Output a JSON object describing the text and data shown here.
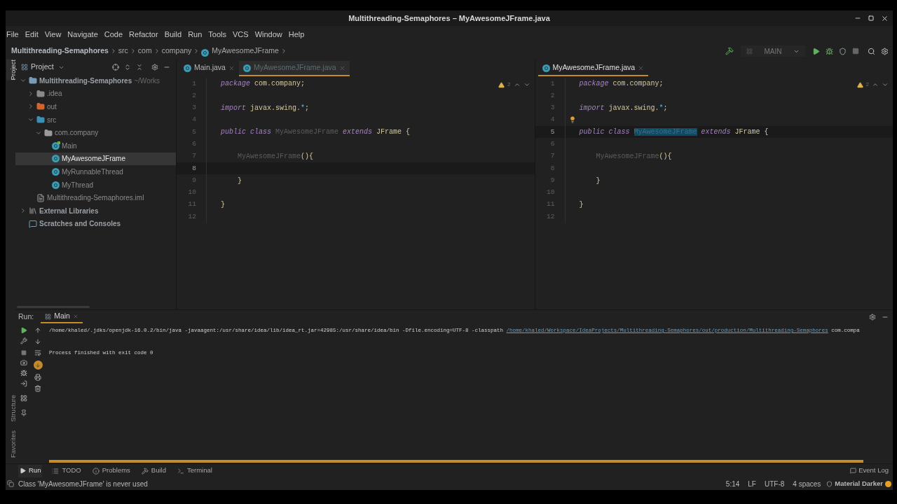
{
  "window": {
    "title": "Multithreading-Semaphores – MyAwesomeJFrame.java"
  },
  "menu": [
    "File",
    "Edit",
    "View",
    "Navigate",
    "Code",
    "Refactor",
    "Build",
    "Run",
    "Tools",
    "VCS",
    "Window",
    "Help"
  ],
  "breadcrumb": [
    {
      "label": "Multithreading-Semaphores",
      "kind": "project"
    },
    {
      "label": "src",
      "kind": "folder"
    },
    {
      "label": "com",
      "kind": "folder"
    },
    {
      "label": "company",
      "kind": "folder"
    },
    {
      "label": "MyAwesomeJFrame",
      "kind": "class"
    }
  ],
  "toolbar": {
    "run_config": "MAIN"
  },
  "side_stripe": {
    "top": [
      {
        "label": "Project",
        "selected": true
      }
    ],
    "bottom": [
      {
        "label": "Structure",
        "selected": false
      },
      {
        "label": "Favorites",
        "selected": false
      }
    ]
  },
  "project": {
    "title": "Project",
    "tree": [
      {
        "label": "Multithreading-Semaphores",
        "path": "~/Works",
        "kind": "module",
        "expanded": true,
        "selected": false,
        "children": [
          {
            "label": ".idea",
            "kind": "folder",
            "expanded": false,
            "selected": false
          },
          {
            "label": "out",
            "kind": "excluded-folder",
            "expanded": false,
            "selected": false
          },
          {
            "label": "src",
            "kind": "source-folder",
            "expanded": true,
            "selected": false,
            "children": [
              {
                "label": "com.company",
                "kind": "package",
                "expanded": true,
                "selected": false,
                "children": [
                  {
                    "label": "Main",
                    "kind": "main-class",
                    "selected": false
                  },
                  {
                    "label": "MyAwesomeJFrame",
                    "kind": "class",
                    "selected": true
                  },
                  {
                    "label": "MyRunnableThread",
                    "kind": "class",
                    "selected": false
                  },
                  {
                    "label": "MyThread",
                    "kind": "class",
                    "selected": false
                  }
                ]
              }
            ]
          },
          {
            "label": "Multithreading-Semaphores.iml",
            "kind": "file",
            "selected": false
          }
        ]
      },
      {
        "label": "External Libraries",
        "kind": "libraries",
        "expanded": false,
        "selected": false
      },
      {
        "label": "Scratches and Consoles",
        "kind": "scratches",
        "selected": false
      }
    ]
  },
  "editors": [
    {
      "tabs": [
        {
          "label": "Main.java",
          "selected": false,
          "dragging": false
        },
        {
          "label": "MyAwesomeJFrame.java",
          "selected": true,
          "dragging": true
        }
      ],
      "warnings": "2",
      "lightbulb": false,
      "lines": [
        {
          "number": "1",
          "current": false,
          "tokens": [
            {
              "text": "package",
              "kind": "keyword"
            },
            {
              "text": " com.company;",
              "kind": "plain"
            }
          ]
        },
        {
          "number": "2",
          "current": false
        },
        {
          "number": "3",
          "current": false,
          "tokens": [
            {
              "text": "import",
              "kind": "keyword"
            },
            {
              "text": " javax.swing.",
              "kind": "plain"
            },
            {
              "text": "*",
              "kind": "operator"
            },
            {
              "text": ";",
              "kind": "plain"
            }
          ]
        },
        {
          "number": "4",
          "current": false
        },
        {
          "number": "5",
          "current": false,
          "tokens": [
            {
              "text": "public class ",
              "kind": "keyword"
            },
            {
              "text": "MyAwesomeJFrame",
              "kind": "unused"
            },
            {
              "text": " extends",
              "kind": "keyword"
            },
            {
              "text": " JFrame {",
              "kind": "plain"
            }
          ]
        },
        {
          "number": "6",
          "current": false
        },
        {
          "number": "7",
          "current": false,
          "tokens": [
            {
              "text": "    MyAwesomeJFrame",
              "kind": "unused"
            },
            {
              "text": "(){",
              "kind": "plain"
            }
          ]
        },
        {
          "number": "8",
          "current": true
        },
        {
          "number": "9",
          "current": false,
          "tokens": [
            {
              "text": "    }",
              "kind": "plain"
            }
          ]
        },
        {
          "number": "10",
          "current": false
        },
        {
          "number": "11",
          "current": false,
          "tokens": [
            {
              "text": "}",
              "kind": "plain"
            }
          ]
        },
        {
          "number": "12",
          "current": false
        }
      ]
    },
    {
      "tabs": [
        {
          "label": "MyAwesomeJFrame.java",
          "selected": true,
          "dragging": false
        }
      ],
      "warnings": "2",
      "lightbulb": true,
      "lines": [
        {
          "number": "1",
          "current": false,
          "tokens": [
            {
              "text": "package",
              "kind": "keyword"
            },
            {
              "text": " com.company;",
              "kind": "plain"
            }
          ]
        },
        {
          "number": "2",
          "current": false
        },
        {
          "number": "3",
          "current": false,
          "tokens": [
            {
              "text": "import",
              "kind": "keyword"
            },
            {
              "text": " javax.swing.",
              "kind": "plain"
            },
            {
              "text": "*",
              "kind": "operator"
            },
            {
              "text": ";",
              "kind": "plain"
            }
          ]
        },
        {
          "number": "4",
          "current": false
        },
        {
          "number": "5",
          "current": true,
          "tokens": [
            {
              "text": "public class ",
              "kind": "keyword"
            },
            {
              "text": "MyAwesomeJFrame",
              "kind": "highlighted"
            },
            {
              "text": " extends",
              "kind": "keyword"
            },
            {
              "text": " JFrame {",
              "kind": "plain"
            }
          ]
        },
        {
          "number": "6",
          "current": false
        },
        {
          "number": "7",
          "current": false,
          "tokens": [
            {
              "text": "    MyAwesomeJFrame",
              "kind": "unused"
            },
            {
              "text": "(){",
              "kind": "plain"
            }
          ]
        },
        {
          "number": "8",
          "current": false
        },
        {
          "number": "9",
          "current": false,
          "tokens": [
            {
              "text": "    }",
              "kind": "plain"
            }
          ]
        },
        {
          "number": "10",
          "current": false
        },
        {
          "number": "11",
          "current": false,
          "tokens": [
            {
              "text": "}",
              "kind": "plain"
            }
          ]
        },
        {
          "number": "12",
          "current": false
        }
      ]
    }
  ],
  "run": {
    "label": "Run:",
    "tabs": [
      {
        "label": "Main",
        "selected": true
      }
    ],
    "console": [
      [
        {
          "text": "/home/khaled/.jdks/openjdk-16.0.2/bin/java -javaagent:/usr/share/idea/lib/idea_rt.jar=42985:/usr/share/idea/bin -Dfile.encoding=UTF-8 -classpath ",
          "kind": "plain"
        },
        {
          "text": "/home/khaled/Workspace/IdeaProjects/Multithreading-Semaphores/out/production/Multithreading-Semaphores",
          "kind": "link"
        },
        {
          "text": " com.compa",
          "kind": "plain"
        }
      ],
      [
        {
          "text": "Process finished with exit code 0",
          "kind": "plain"
        }
      ]
    ],
    "scroll_to_end": true
  },
  "tool_tabs": [
    {
      "label": "Run",
      "kind": "run",
      "selected": true
    },
    {
      "label": "TODO",
      "kind": "todo",
      "selected": false
    },
    {
      "label": "Problems",
      "kind": "problems",
      "selected": false
    },
    {
      "label": "Build",
      "kind": "build",
      "selected": false
    },
    {
      "label": "Terminal",
      "kind": "terminal",
      "selected": false
    }
  ],
  "event_log": "Event Log",
  "status_bar": {
    "message": "Class 'MyAwesomeJFrame' is never used",
    "items": [
      "5:14",
      "LF",
      "UTF-8",
      "4 spaces"
    ],
    "theme": "Material Darker"
  }
}
